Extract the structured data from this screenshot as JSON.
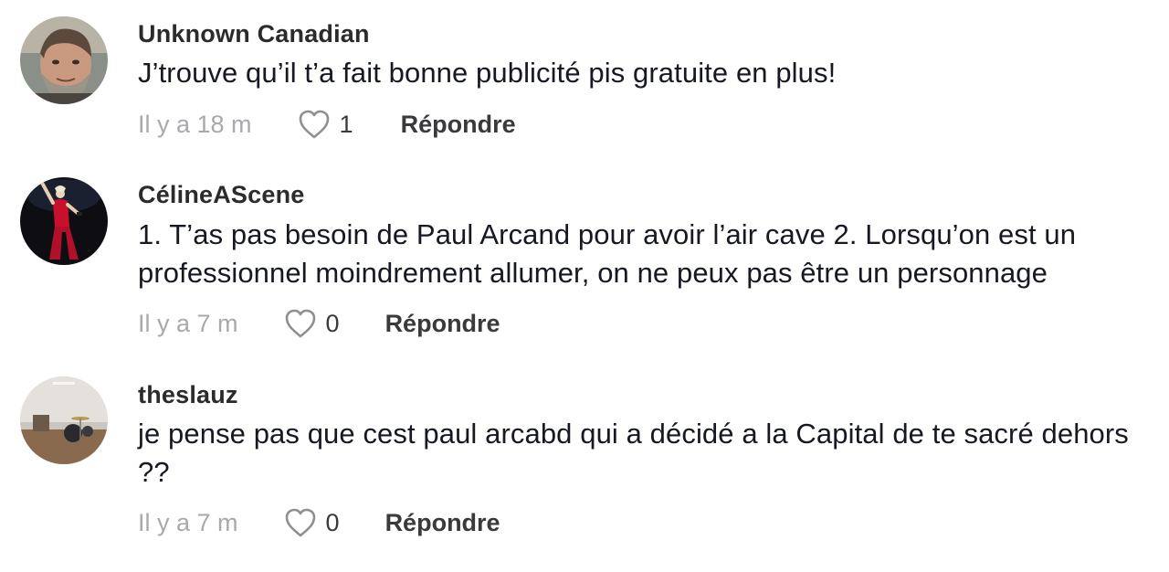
{
  "comments": [
    {
      "username": "Unknown Canadian",
      "text": "J’trouve qu’il t’a fait bonne publicité pis gratuite en plus!",
      "timestamp": "Il y a 18 m",
      "likes": "1",
      "reply_label": "Répondre",
      "avatar_icon": "avatar-bearded-man"
    },
    {
      "username": "CélineAScene",
      "text": "1. T’as pas besoin de Paul Arcand pour avoir l’air cave 2. Lorsqu’on est un professionnel moindrement allumer, on ne peux pas être un personnage",
      "timestamp": "Il y a 7 m",
      "likes": "0",
      "reply_label": "Répondre",
      "avatar_icon": "avatar-singer-stage"
    },
    {
      "username": "theslauz",
      "text": "je pense pas que cest paul arcabd qui a décidé a la Capital de te sacré dehors ??",
      "timestamp": "Il y a 7 m",
      "likes": "0",
      "reply_label": "Répondre",
      "avatar_icon": "avatar-drum-room"
    }
  ],
  "colors": {
    "text": "#161823",
    "muted": "#a9a9ad",
    "action": "#3a3a3d"
  }
}
